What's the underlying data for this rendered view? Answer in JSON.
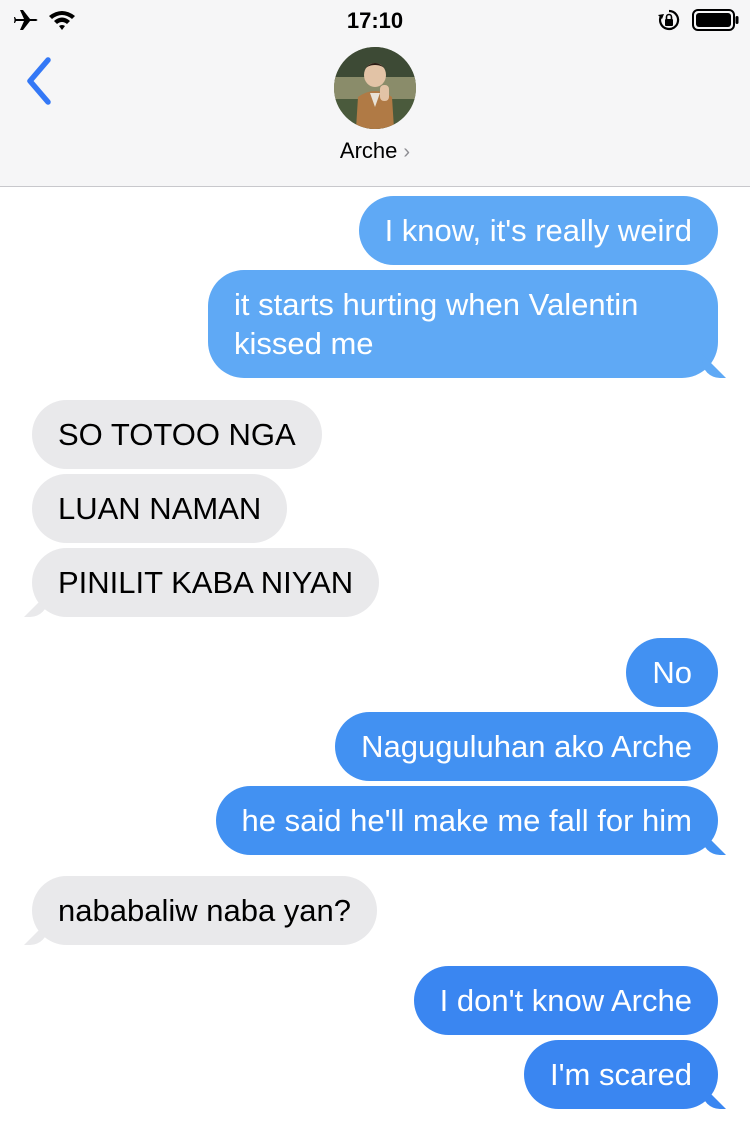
{
  "status_bar": {
    "time": "17:10",
    "icons": [
      "airplane-icon",
      "wifi-icon",
      "orientation-lock-icon",
      "battery-icon"
    ]
  },
  "header": {
    "back_icon": "chevron-left-icon",
    "contact_name": "Arche",
    "contact_chevron": "›"
  },
  "colors": {
    "accent": "#3478f6",
    "bubble_out_light": "#60aaf5",
    "bubble_out": "#3a86f1",
    "bubble_in": "#e9e9eb"
  },
  "messages": [
    {
      "direction": "outgoing",
      "text": "I know, it's really weird"
    },
    {
      "direction": "outgoing",
      "text": "it starts hurting when Valentin kissed me"
    },
    {
      "direction": "incoming",
      "text": "SO TOTOO NGA"
    },
    {
      "direction": "incoming",
      "text": "LUAN NAMAN"
    },
    {
      "direction": "incoming",
      "text": "PINILIT KABA NIYAN"
    },
    {
      "direction": "outgoing",
      "text": "No"
    },
    {
      "direction": "outgoing",
      "text": "Naguguluhan ako Arche"
    },
    {
      "direction": "outgoing",
      "text": "he said he'll make me fall for him"
    },
    {
      "direction": "incoming",
      "text": "nababaliw naba yan?"
    },
    {
      "direction": "outgoing",
      "text": "I don't know Arche"
    },
    {
      "direction": "outgoing",
      "text": "I'm scared"
    }
  ]
}
